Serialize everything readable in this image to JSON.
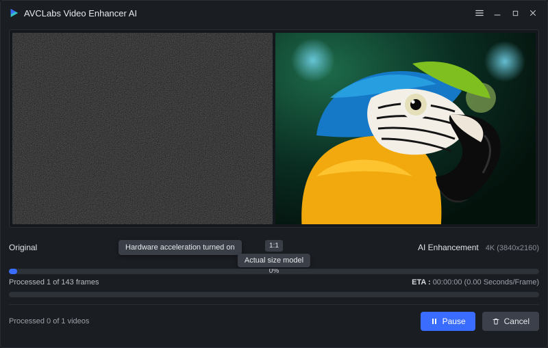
{
  "app": {
    "title": "AVCLabs Video Enhancer AI"
  },
  "labels": {
    "original": "Original",
    "enhancement": "AI Enhancement",
    "resolution": "4K (3840x2160)",
    "ratio": "1:1"
  },
  "tooltips": {
    "hw_accel": "Hardware acceleration turned on",
    "actual_size": "Actual size model"
  },
  "progress": {
    "frames": {
      "done": 1,
      "total": 143,
      "percent_text": "0%",
      "fill_pct": 1.5
    },
    "videos": {
      "done": 0,
      "total": 1,
      "fill_pct": 0
    },
    "frames_label": "Processed 1 of 143 frames",
    "videos_label": "Processed 0 of 1 videos",
    "eta_label": "ETA :",
    "eta_value": "00:00:00 (0.00 Seconds/Frame)"
  },
  "buttons": {
    "pause": "Pause",
    "cancel": "Cancel"
  },
  "colors": {
    "accent": "#3a6cff",
    "bg": "#1a1d22"
  }
}
